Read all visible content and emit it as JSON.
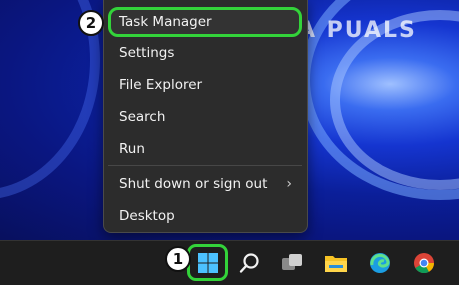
{
  "watermark": "A PUALS",
  "menu": {
    "items": [
      {
        "label": "Task Manager"
      },
      {
        "label": "Settings"
      },
      {
        "label": "File Explorer"
      },
      {
        "label": "Search"
      },
      {
        "label": "Run"
      },
      {
        "label": "Shut down or sign out",
        "submenu_icon": "chevron-right-icon"
      },
      {
        "label": "Desktop"
      }
    ]
  },
  "badges": {
    "step1": "1",
    "step2": "2"
  },
  "taskbar": {
    "icons": [
      "windows-start-icon",
      "search-icon",
      "task-view-icon",
      "file-explorer-icon",
      "edge-icon",
      "chrome-icon"
    ]
  },
  "colors": {
    "highlight": "#33d33a",
    "menu_bg": "#2c2c2c",
    "taskbar_bg": "#1e1e1e"
  }
}
